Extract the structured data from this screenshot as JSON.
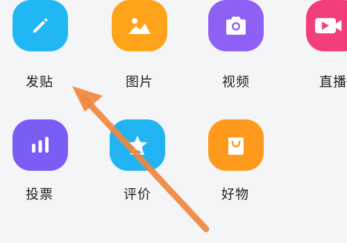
{
  "grid": {
    "items": [
      {
        "label": "发贴",
        "icon": "pencil-icon",
        "color": "#21b7f5"
      },
      {
        "label": "图片",
        "icon": "image-icon",
        "color": "#ffa31a"
      },
      {
        "label": "视频",
        "icon": "camera-icon",
        "color": "#8f60f4"
      },
      {
        "label": "直播",
        "icon": "video-play-icon",
        "color": "#f23f7a"
      },
      {
        "label": "投票",
        "icon": "bar-chart-icon",
        "color": "#7b5cf5"
      },
      {
        "label": "评价",
        "icon": "star-icon",
        "color": "#22b4f2"
      },
      {
        "label": "好物",
        "icon": "shopping-bag-icon",
        "color": "#ff9a1c"
      }
    ]
  },
  "overlay": {
    "arrow_color": "#f0883e"
  }
}
